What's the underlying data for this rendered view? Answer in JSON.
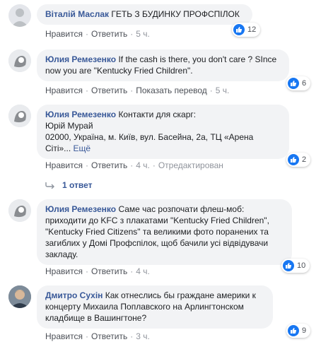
{
  "comments": [
    {
      "author": "Віталій Маслак",
      "lines": [
        "ГЕТЬ З БУДИНКУ ПРОФСПІЛОК"
      ],
      "actions": {
        "like": "Нравится",
        "reply": "Ответить",
        "time": "5 ч."
      },
      "reactions": "12"
    },
    {
      "author": "Юлия Ремезенко",
      "lines": [
        "If the cash is there, you don't care ? SInce",
        "now you are \"Kentucky Fried Children\"."
      ],
      "actions": {
        "like": "Нравится",
        "reply": "Ответить",
        "translate": "Показать перевод",
        "time": "5 ч."
      },
      "reactions": "6"
    },
    {
      "author": "Юлия Ремезенко",
      "lines": [
        "Контакти для скарг:",
        "Юрій Мурай",
        "02000, Україна, м. Київ, вул. Басейна, 2а, ТЦ «Арена",
        "Сіті»..."
      ],
      "more": "Ещё",
      "actions": {
        "like": "Нравится",
        "reply": "Ответить",
        "time": "4 ч.",
        "edited": "Отредактирован"
      },
      "reactions": "2",
      "replies": "1 ответ"
    },
    {
      "author": "Юлия Ремезенко",
      "lines": [
        "Саме час розпочати флеш-моб:",
        "приходити до KFC з плакатами \"Kentucky Fried Children\",",
        "\"Kentucky Fried Citizens\" та великими фото поранених та",
        "загиблих у Домі Профспілок, щоб бачили усі відвідувачи",
        "закладу."
      ],
      "actions": {
        "like": "Нравится",
        "reply": "Ответить",
        "time": "4 ч."
      },
      "reactions": "10"
    },
    {
      "author": "Дмитро Сухін",
      "lines": [
        "Как отнеслись бы граждане америки к",
        "концерту Михаила Поплавского на Арлингтонском",
        "кладбище в Вашингтоне?"
      ],
      "actions": {
        "like": "Нравится",
        "reply": "Ответить",
        "time": "3 ч."
      },
      "reactions": "9"
    }
  ],
  "colors": {
    "author": "#385898",
    "bubble": "#f2f3f5",
    "like": "#1877f2",
    "muted": "#90949c"
  },
  "icons": {
    "like": "thumbs-up-icon",
    "reply": "reply-arrow-icon"
  }
}
